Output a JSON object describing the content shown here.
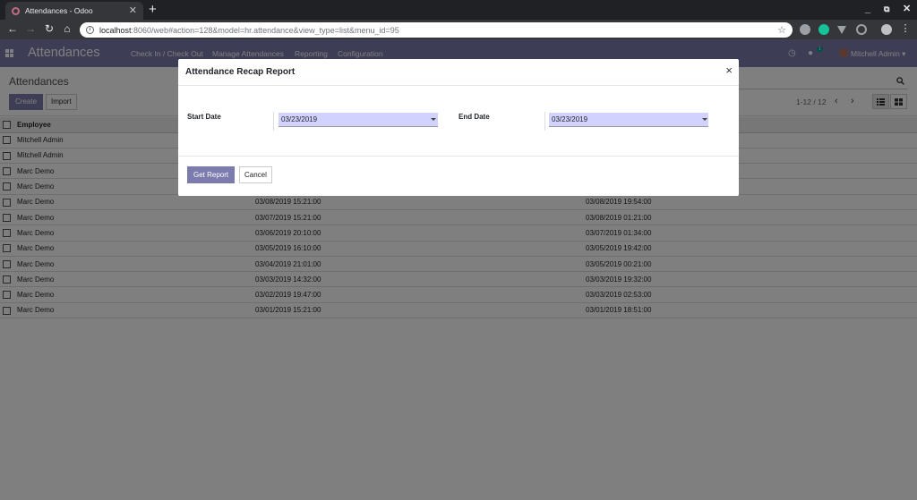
{
  "browser": {
    "tab_title": "Attendances - Odoo",
    "url_host": "localhost",
    "url_path": ":8060/web#action=128&model=hr.attendance&view_type=list&menu_id=95"
  },
  "odoo": {
    "app_title": "Attendances",
    "menu": [
      "Check In / Check Out",
      "Manage Attendances",
      "Reporting",
      "Configuration"
    ],
    "user_name": "Mitchell Admin",
    "chat_badge": "1"
  },
  "control_panel": {
    "breadcrumb": "Attendances",
    "create_label": "Create",
    "import_label": "Import",
    "pager": "1-12 / 12"
  },
  "list": {
    "header_employee": "Employee",
    "rows": [
      {
        "employee": "Mitchell Admin",
        "check_in": "",
        "check_out": ""
      },
      {
        "employee": "Mitchell Admin",
        "check_in": "",
        "check_out": ""
      },
      {
        "employee": "Marc Demo",
        "check_in": "",
        "check_out": ""
      },
      {
        "employee": "Marc Demo",
        "check_in": "",
        "check_out": ""
      },
      {
        "employee": "Marc Demo",
        "check_in": "03/08/2019 15:21:00",
        "check_out": "03/08/2019 19:54:00"
      },
      {
        "employee": "Marc Demo",
        "check_in": "03/07/2019 15:21:00",
        "check_out": "03/08/2019 01:21:00"
      },
      {
        "employee": "Marc Demo",
        "check_in": "03/06/2019 20:10:00",
        "check_out": "03/07/2019 01:34:00"
      },
      {
        "employee": "Marc Demo",
        "check_in": "03/05/2019 16:10:00",
        "check_out": "03/05/2019 19:42:00"
      },
      {
        "employee": "Marc Demo",
        "check_in": "03/04/2019 21:01:00",
        "check_out": "03/05/2019 00:21:00"
      },
      {
        "employee": "Marc Demo",
        "check_in": "03/03/2019 14:32:00",
        "check_out": "03/03/2019 19:32:00"
      },
      {
        "employee": "Marc Demo",
        "check_in": "03/02/2019 19:47:00",
        "check_out": "03/03/2019 02:53:00"
      },
      {
        "employee": "Marc Demo",
        "check_in": "03/01/2019 15:21:00",
        "check_out": "03/01/2019 18:51:00"
      }
    ]
  },
  "dialog": {
    "title": "Attendance Recap Report",
    "close_label": "×",
    "start_label": "Start Date",
    "start_value": "03/23/2019",
    "end_label": "End Date",
    "end_value": "03/23/2019",
    "get_report_label": "Get Report",
    "cancel_label": "Cancel"
  },
  "colors": {
    "brand": "#7c7bad",
    "date_field": "#d2d2ff"
  }
}
